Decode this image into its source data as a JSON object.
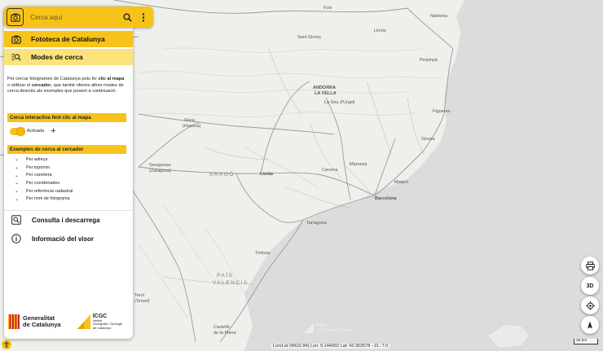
{
  "search": {
    "placeholder": "Cerca aquí"
  },
  "menu": {
    "fototeca": "Fototeca de Catalunya",
    "modes": "Modes de cerca",
    "consulta": "Consulta i descarrega",
    "informacio": "Informació del visor"
  },
  "description": {
    "p1": "Per cercar fotogrames de Catalunya pots fer ",
    "b1": "clic al mapa",
    "p2": " o utilitzar el ",
    "b2": "cercador",
    "p3": ", que també ofereix altres modes de cerca descrits als exemples que posem a continuació."
  },
  "interactive": {
    "header": "Cerca interactiva fent clic al mapa",
    "toggle_label": "Activada",
    "plus": "+"
  },
  "examples": {
    "header": "Exemples de cerca al cercador",
    "items": [
      "Per adreça",
      "Per topònim",
      "Per carretera",
      "Per coordenades",
      "Per referència cadastral",
      "Per nom de fotograma"
    ]
  },
  "logos": {
    "generalitat": [
      "Generalitat",
      "de Catalunya"
    ],
    "icgc_title": "ICGC",
    "icgc_sub": [
      "Institut",
      "Cartogràfic i Geològic",
      "de Catalunya"
    ]
  },
  "map_controls": {
    "print_icon": "printer-icon",
    "three_d": "3D",
    "locate_icon": "crosshair-icon",
    "north_icon": "compass-icon"
  },
  "status": {
    "coords": "Lon/Lat (WGS 84) Lon: 5.144092 Lat: 42.363578 - ZL: 7.0",
    "scale": "30 km"
  },
  "map_labels": {
    "cities": [
      "Foix",
      "Narbona",
      "Limós",
      "Sant Gironç",
      "Perpinyà",
      "ANDORRA",
      "LA VELLA",
      "La Seu d'Urgell",
      "Figueres",
      "Girona",
      "Osca",
      "(Huesca)",
      "Saragossa",
      "(Zaragoza)",
      "Lleida",
      "Manresa",
      "Cervera",
      "Mataró",
      "Barcelona",
      "Tarragona",
      "Tortosa",
      "Terol",
      "(Teruel)",
      "Castelló",
      "de la Plana"
    ],
    "regions": [
      "ARAGÓ",
      "PAÍS",
      "VALENCIÀ"
    ]
  },
  "ghost_logo": {
    "title": "ICGC",
    "sub": "Institut Cartogràfic i Geològic"
  }
}
